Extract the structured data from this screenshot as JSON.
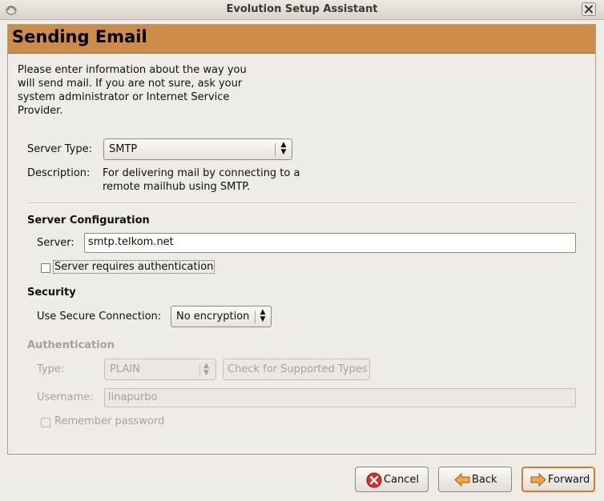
{
  "window": {
    "title": "Evolution Setup Assistant"
  },
  "page": {
    "title": "Sending Email",
    "intro_lines": [
      "Please enter information about the way you",
      "will send mail. If you are not sure, ask your",
      "system administrator or Internet Service",
      "Provider."
    ]
  },
  "server_type": {
    "label": "Server Type:",
    "value": "SMTP",
    "description_label": "Description:",
    "description_lines": [
      "For delivering mail by connecting to a",
      "remote mailhub using SMTP."
    ]
  },
  "server_configuration": {
    "heading": "Server Configuration",
    "server_label": "Server:",
    "server_value": "smtp.telkom.net",
    "auth_required_label": "Server requires authentication",
    "auth_required_checked": false
  },
  "security": {
    "heading": "Security",
    "secure_label": "Use Secure Connection:",
    "secure_value": "No encryption"
  },
  "authentication": {
    "heading": "Authentication",
    "type_label": "Type:",
    "type_value": "PLAIN",
    "check_button_label": "Check for Supported Types",
    "username_label": "Username:",
    "username_value": "linapurbo",
    "remember_label": "Remember password",
    "enabled": false
  },
  "buttons": {
    "cancel": "Cancel",
    "back": "Back",
    "forward": "Forward"
  },
  "colors": {
    "banner": "#cd8c4a",
    "window_bg": "#efebe7",
    "default_button_border": "#d77c2c",
    "cancel_icon": "#d8312a"
  },
  "icons": {
    "app": "evolution-icon",
    "close": "close-icon",
    "cancel": "cancel-icon",
    "back": "back-arrow-icon",
    "forward": "forward-arrow-icon"
  }
}
